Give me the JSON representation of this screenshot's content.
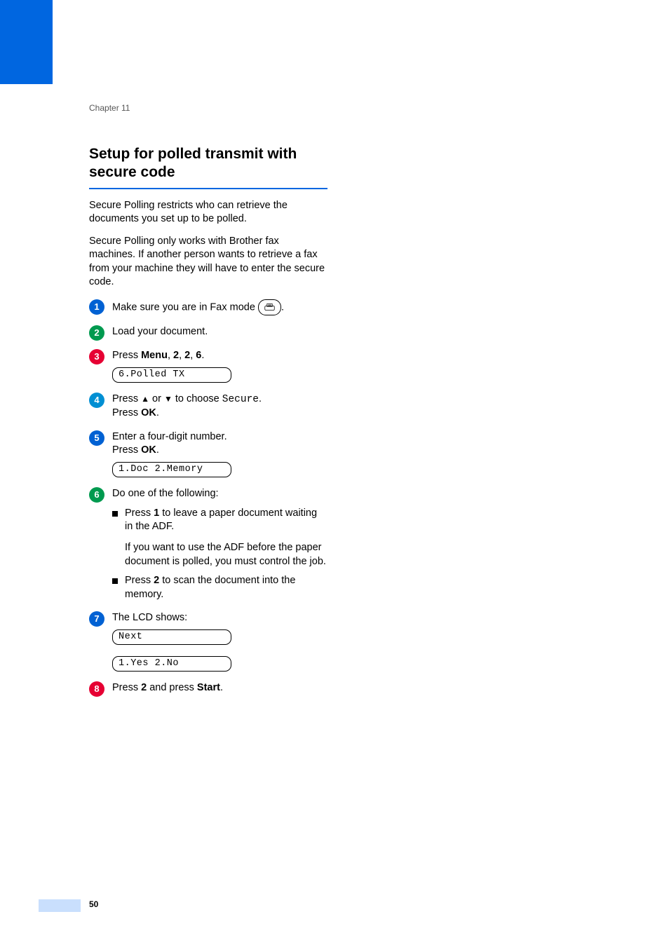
{
  "chapter_label": "Chapter 11",
  "title": "Setup for polled transmit with secure code",
  "intro1": "Secure Polling restricts who can retrieve the documents you set up to be polled.",
  "intro2": "Secure Polling only works with Brother fax machines. If another person wants to retrieve a fax from your machine they will have to enter the secure code.",
  "steps": {
    "s1_a": "Make sure you are in Fax mode ",
    "s1_b": ".",
    "s2": "Load your document.",
    "s3_a": "Press ",
    "s3_menu": "Menu",
    "s3_sep": ", ",
    "s3_2a": "2",
    "s3_2b": "2",
    "s3_6": "6",
    "s3_dot": ".",
    "lcd1": "6.Polled TX",
    "s4_a": "Press ",
    "s4_b": " or ",
    "s4_c": " to choose ",
    "s4_secure": "Secure",
    "s4_d": ".",
    "s4_e": "Press ",
    "s4_ok": "OK",
    "s5_a": "Enter a four-digit number.",
    "s5_b": "Press ",
    "s5_ok": "OK",
    "lcd2": "1.Doc 2.Memory",
    "s6": "Do one of the following:",
    "s6_b1_a": "Press ",
    "s6_b1_1": "1",
    "s6_b1_b": " to leave a paper document waiting in the ADF.",
    "s6_note": "If you want to use the ADF before the paper document is polled, you must control the job.",
    "s6_b2_a": "Press ",
    "s6_b2_2": "2",
    "s6_b2_b": " to scan the document into the memory.",
    "s7": "The LCD shows:",
    "lcd3": "Next",
    "lcd4": "1.Yes 2.No",
    "s8_a": "Press ",
    "s8_2": "2",
    "s8_b": " and press ",
    "s8_start": "Start",
    "s8_c": "."
  },
  "page_number": "50"
}
